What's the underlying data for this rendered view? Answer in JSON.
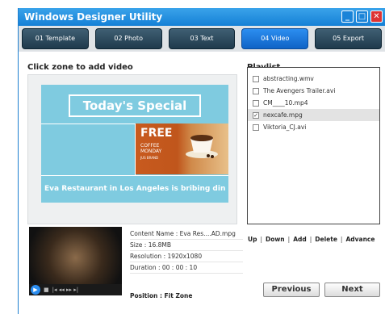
{
  "window": {
    "title": "Windows Designer Utility",
    "minimize": "_",
    "maximize": "□",
    "close": "✕"
  },
  "tabs": [
    "01 Template",
    "02 Photo",
    "03 Text",
    "04 Video",
    "05 Export"
  ],
  "active_tab": "04 Video",
  "left_label": "Click zone to add video",
  "preview": {
    "headline": "Today's Special",
    "promo_title": "FREE",
    "promo_line1": "COFFEE",
    "promo_line2": "MONDAY",
    "promo_line3": "JUS BRAND",
    "caption": "Eva Restaurant in Los Angeles is bribing dine"
  },
  "playlist": {
    "label": "Playlist",
    "items": [
      {
        "name": "abstracting.wmv",
        "checked": false
      },
      {
        "name": "The Avengers Trailer.avi",
        "checked": false
      },
      {
        "name": "CM____10.mp4",
        "checked": false
      },
      {
        "name": "nexcafe.mpg",
        "checked": true
      },
      {
        "name": "Viktoria_CJ.avi",
        "checked": false
      }
    ]
  },
  "video_info": {
    "content_name": "Content Name : Eva Res....AD.mpg",
    "size": "Size : 16.8MB",
    "resolution": "Resolution : 1920x1080",
    "duration": "Duration : 00 : 00 : 10"
  },
  "position": "Position : Fit Zone",
  "actions": {
    "up": "Up",
    "down": "Down",
    "add": "Add",
    "delete": "Delete",
    "advance": "Advance",
    "separator": "|"
  },
  "player": {
    "play": "▶",
    "stop": "■",
    "controls": "|◂ ◂◂ ▸▸ ▸|"
  },
  "buttons": {
    "previous": "Previous",
    "next": "Next"
  },
  "colors": {
    "accent": "#1580d6",
    "tab_active": "#2c8ef0",
    "tab_inactive": "#1f3a4c",
    "preview_bg": "#7fcbe0"
  }
}
